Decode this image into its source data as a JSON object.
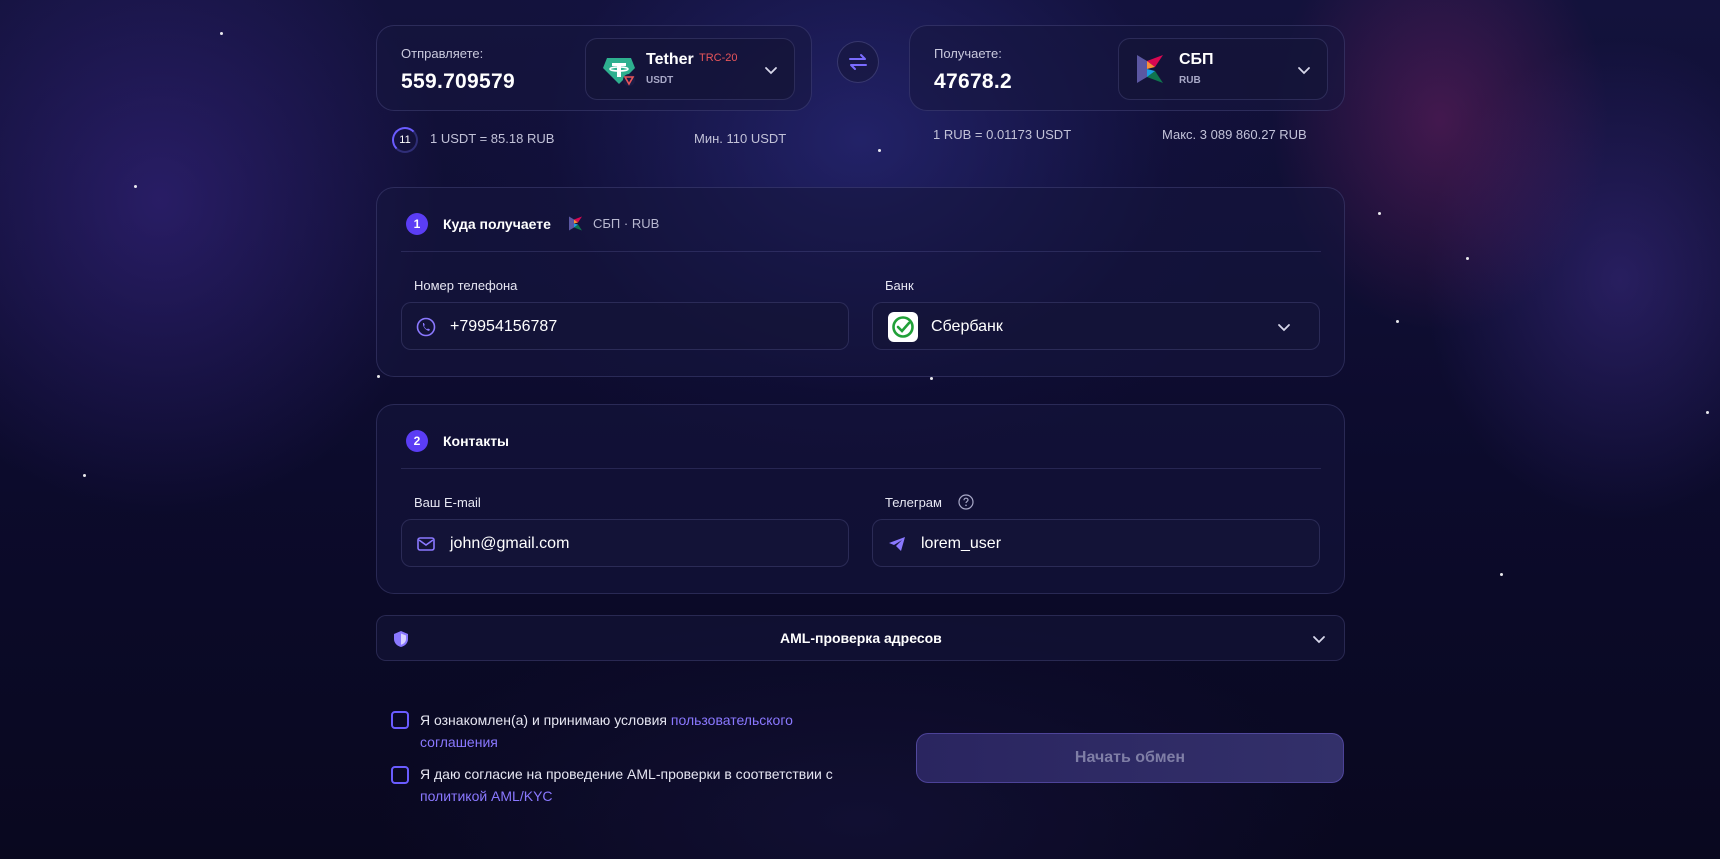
{
  "exchange": {
    "send": {
      "label": "Отправляете:",
      "amount": "559.709579",
      "currency_name": "Tether",
      "network": "TRC-20",
      "currency_code": "USDT",
      "icon": "tether-icon"
    },
    "receive": {
      "label": "Получаете:",
      "amount": "47678.2",
      "currency_name": "СБП",
      "currency_code": "RUB",
      "icon": "sbp-icon"
    },
    "timer": "11",
    "rate_send": "1 USDT = 85.18 RUB",
    "min": "Мин. 110 USDT",
    "rate_receive": "1 RUB = 0.01173 USDT",
    "max": "Макс. 3 089 860.27 RUB"
  },
  "step1": {
    "number": "1",
    "title": "Куда получаете",
    "subtitle": "СБП · RUB",
    "phone_label": "Номер телефона",
    "phone_value": "+79954156787",
    "bank_label": "Банк",
    "bank_value": "Сбербанк"
  },
  "step2": {
    "number": "2",
    "title": "Контакты",
    "email_label": "Ваш E-mail",
    "email_value": "john@gmail.com",
    "telegram_label": "Телеграм",
    "telegram_value": "lorem_user"
  },
  "aml": {
    "title": "AML-проверка адресов"
  },
  "agreements": {
    "terms_text": "Я ознакомлен(а) и принимаю условия ",
    "terms_link": "пользовательского соглашения",
    "aml_text": "Я даю согласие на проведение AML-проверки в соответствии с ",
    "aml_link": "политикой AML/KYC"
  },
  "start_button": "Начать обмен",
  "colors": {
    "accent": "#5b3df5",
    "link": "#8a78ff",
    "network_red": "#e8555a",
    "background": "#0a0a24"
  }
}
